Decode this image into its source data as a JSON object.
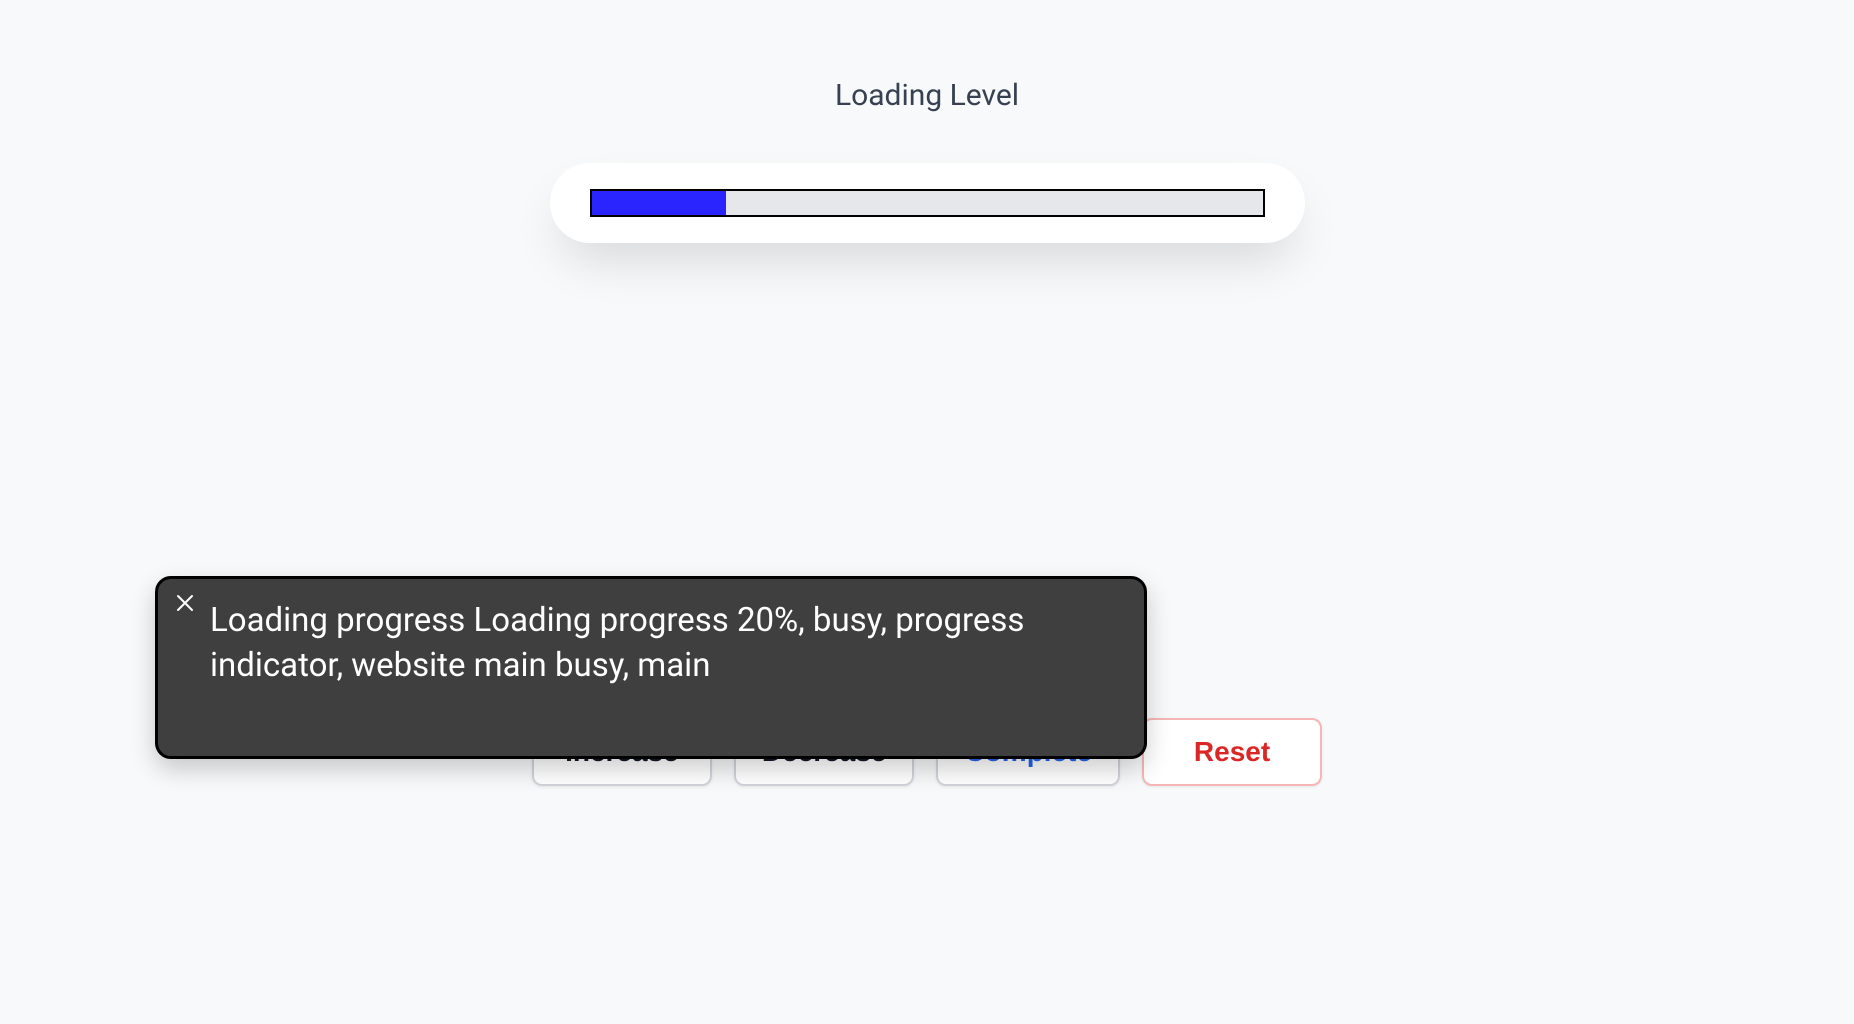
{
  "heading": "Loading Level",
  "progress": {
    "percent": 20
  },
  "tooltip": {
    "text": "Loading progress Loading progress 20%, busy, progress indicator, website main busy, main"
  },
  "buttons": {
    "increase": "Increase",
    "decrease": "Decrease",
    "complete": "Complete",
    "reset": "Reset"
  }
}
